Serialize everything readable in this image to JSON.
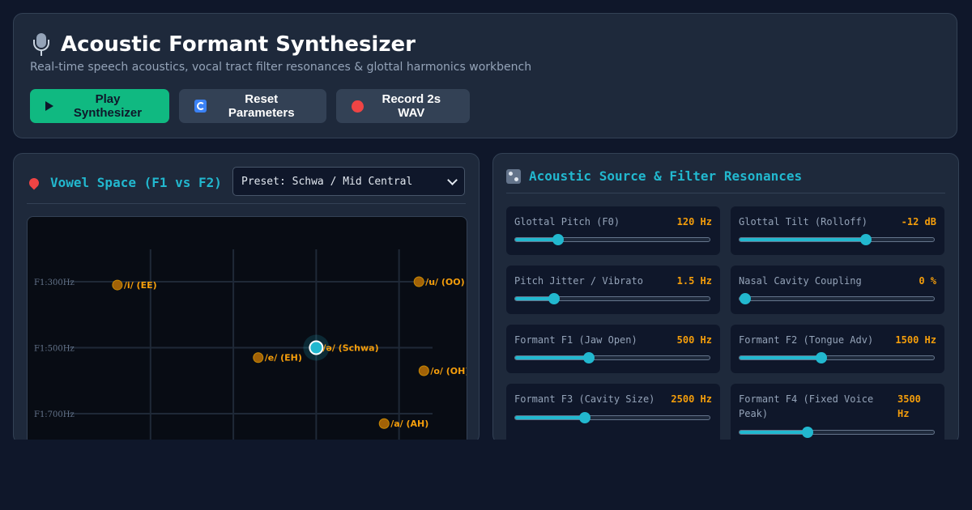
{
  "header": {
    "icon": "microphone-icon",
    "title": "Acoustic Formant Synthesizer",
    "subtitle": "Real-time speech acoustics, vocal tract filter resonances & glottal harmonics workbench",
    "buttons": {
      "play": "Play Synthesizer",
      "reset": "Reset Parameters",
      "record": "Record 2s WAV"
    }
  },
  "vowel_panel": {
    "icon": "pin-icon",
    "title": "Vowel Space (F1 vs F2)",
    "preset_selected": "Preset: Schwa / Mid Central",
    "grid_labels": [
      "F1:300Hz",
      "F1:500Hz",
      "F1:700Hz"
    ],
    "vowels": [
      {
        "label": "/i/ (EE)",
        "f1": 310,
        "f2": 2700
      },
      {
        "label": "/u/ (OO)",
        "f1": 300,
        "f2": 880
      },
      {
        "label": "/e/ (EH)",
        "f1": 530,
        "f2": 1850
      },
      {
        "label": "/ə/ (Schwa)",
        "f1": 500,
        "f2": 1500
      },
      {
        "label": "/o/ (OH)",
        "f1": 570,
        "f2": 850
      },
      {
        "label": "/a/ (AH)",
        "f1": 730,
        "f2": 1090
      }
    ],
    "active_vowel": "/ə/ (Schwa)",
    "colors": {
      "vowel": "#f59e0b",
      "active": "#22b8cf"
    }
  },
  "resonance_panel": {
    "icon": "control-knobs-icon",
    "title": "Acoustic Source & Filter Resonances",
    "sliders": [
      {
        "label": "Glottal Pitch (F0)",
        "value": "120 Hz",
        "fraction": 0.22
      },
      {
        "label": "Glottal Tilt (Rolloff)",
        "value": "-12 dB",
        "fraction": 0.65
      },
      {
        "label": "Pitch Jitter / Vibrato",
        "value": "1.5 Hz",
        "fraction": 0.2
      },
      {
        "label": "Nasal Cavity Coupling",
        "value": "0 %",
        "fraction": 0.03
      },
      {
        "label": "Formant F1 (Jaw Open)",
        "value": "500 Hz",
        "fraction": 0.38
      },
      {
        "label": "Formant F2 (Tongue Adv)",
        "value": "1500 Hz",
        "fraction": 0.42
      },
      {
        "label": "Formant F3 (Cavity Size)",
        "value": "2500 Hz",
        "fraction": 0.36
      },
      {
        "label": "Formant F4 (Fixed Voice Peak)",
        "value": "3500 Hz",
        "fraction": 0.35
      }
    ]
  }
}
